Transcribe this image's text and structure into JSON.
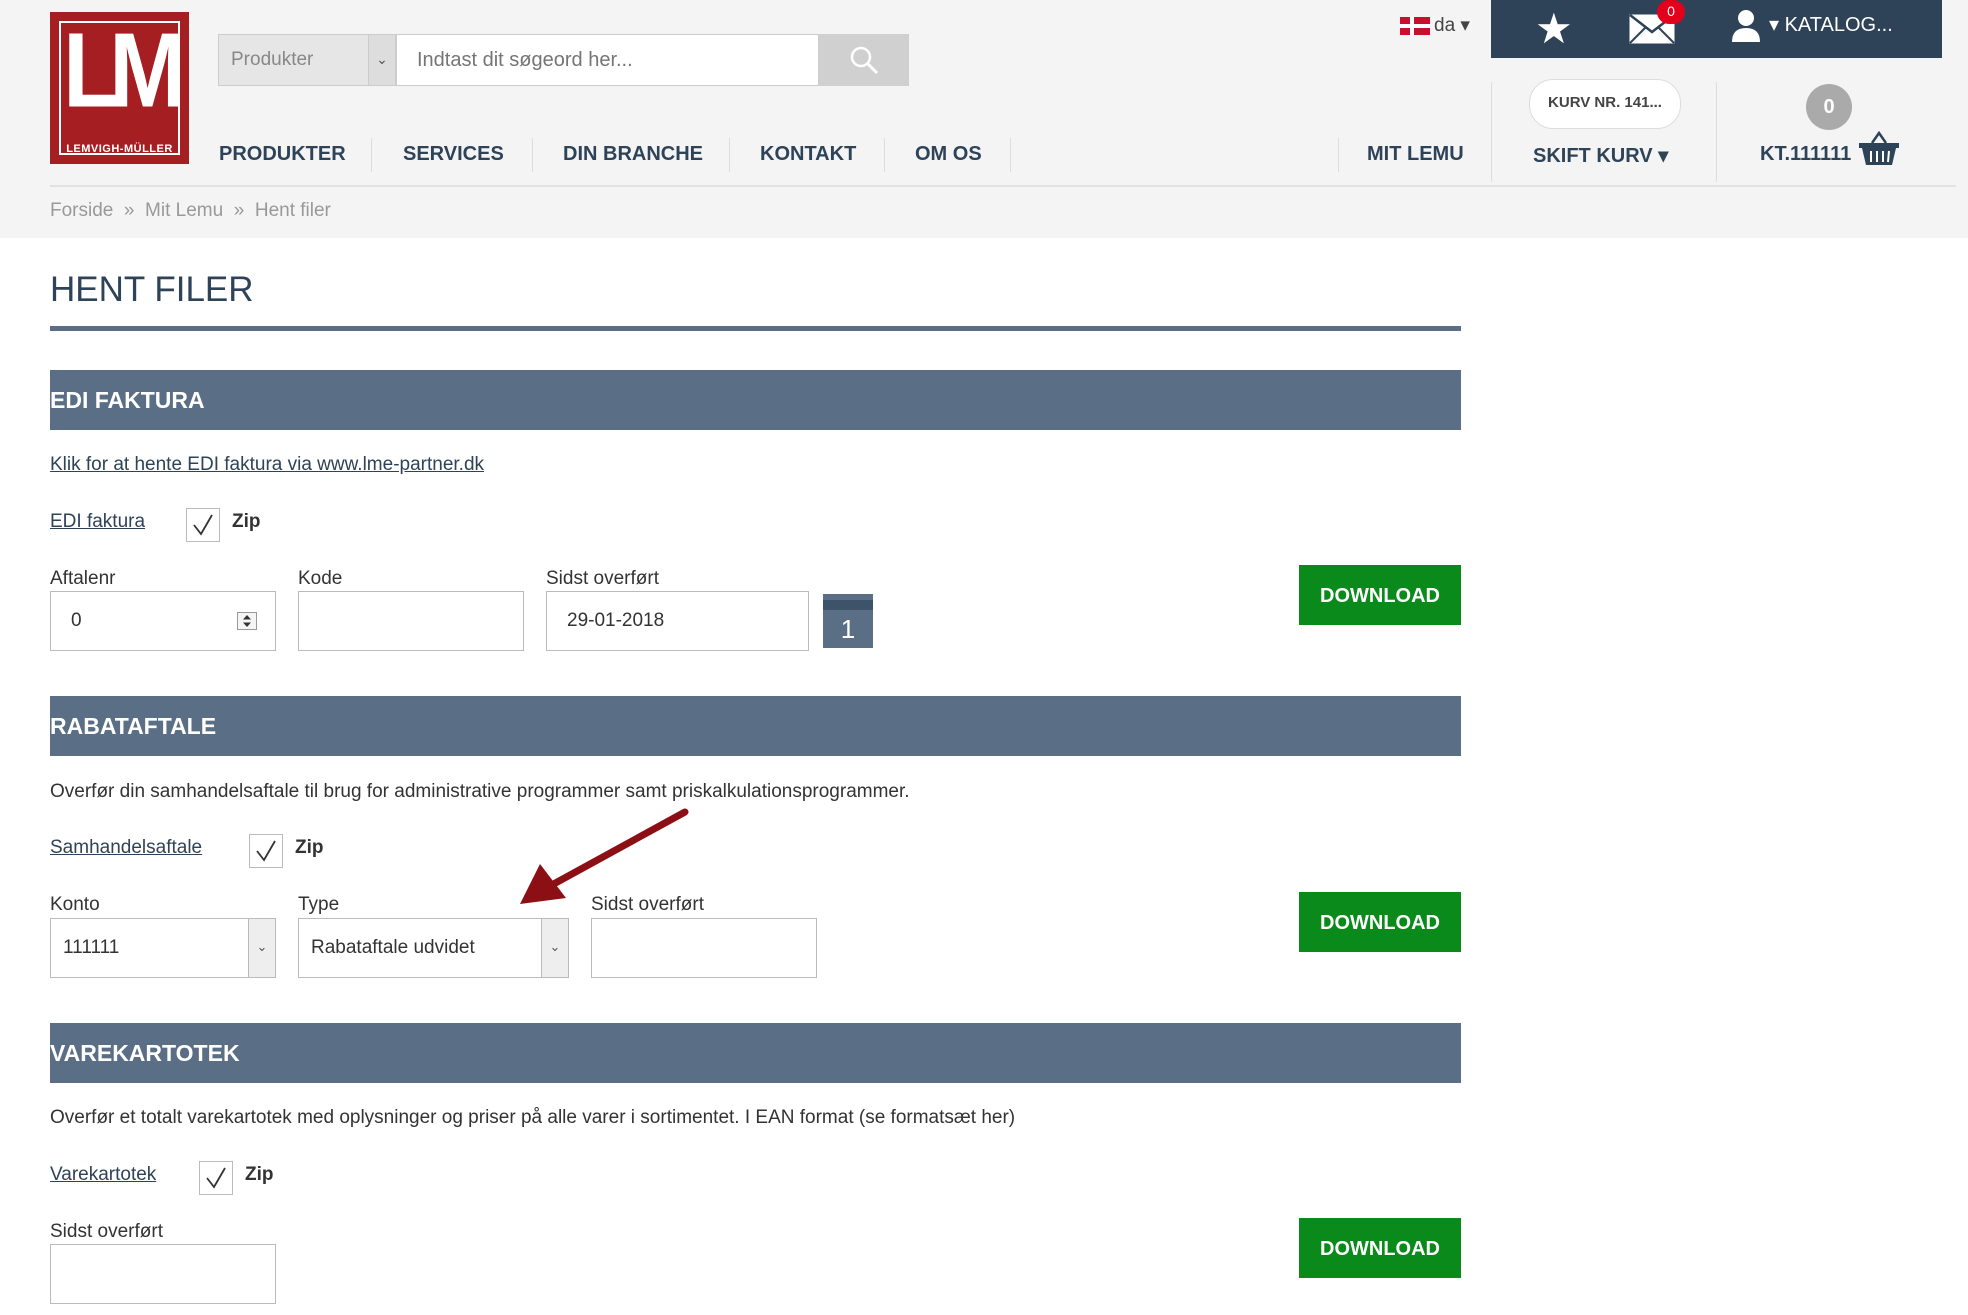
{
  "header": {
    "logo_text": "LEMVIGH-MÜLLER",
    "logo_letters": "LM",
    "search_category": "Produkter",
    "search_placeholder": "Indtast dit søgeord her...",
    "language": "da",
    "mail_count": "0",
    "account_label": "▾ KATALOG...",
    "basket_number": "KURV NR. 141...",
    "cart_count": "0",
    "nav": [
      "PRODUKTER",
      "SERVICES",
      "DIN BRANCHE",
      "KONTAKT",
      "OM OS"
    ],
    "nav_right": {
      "mit_lemu": "MIT LEMU",
      "skift_kurv": "SKIFT KURV ▾",
      "account_number": "KT.111111"
    }
  },
  "breadcrumb": "Forside  »  Mit Lemu  »  Hent filer",
  "page_title": "HENT FILER",
  "sections": {
    "edi": {
      "title": "EDI FAKTURA",
      "link": "Klik for at hente EDI faktura via www.lme-partner.dk",
      "file_link": "EDI faktura",
      "zip_label": "Zip",
      "aftalenr_label": "Aftalenr",
      "aftalenr_value": "0",
      "kode_label": "Kode",
      "kode_value": "",
      "sidst_label": "Sidst overført",
      "sidst_value": "29-01-2018",
      "calendar_day": "1",
      "download": "DOWNLOAD"
    },
    "rabat": {
      "title": "RABATAFTALE",
      "desc": "Overfør din samhandelsaftale til brug for administrative programmer samt priskalkulationsprogrammer.",
      "file_link": "Samhandelsaftale",
      "zip_label": "Zip",
      "konto_label": "Konto",
      "konto_value": "111111",
      "type_label": "Type",
      "type_value": "Rabataftale udvidet",
      "sidst_label": "Sidst overført",
      "sidst_value": "",
      "download": "DOWNLOAD"
    },
    "vare": {
      "title": "VAREKARTOTEK",
      "desc": "Overfør et totalt varekartotek med oplysninger og priser på alle varer i sortimentet. I EAN format (se formatsæt her)",
      "file_link": "Varekartotek",
      "zip_label": "Zip",
      "sidst_label": "Sidst overført",
      "sidst_value": "",
      "download": "DOWNLOAD"
    }
  },
  "colors": {
    "brand_red": "#a51e22",
    "navy": "#2e4358",
    "section": "#5a6f85",
    "download": "#0a8a1a",
    "arrow": "#8b0f14"
  }
}
